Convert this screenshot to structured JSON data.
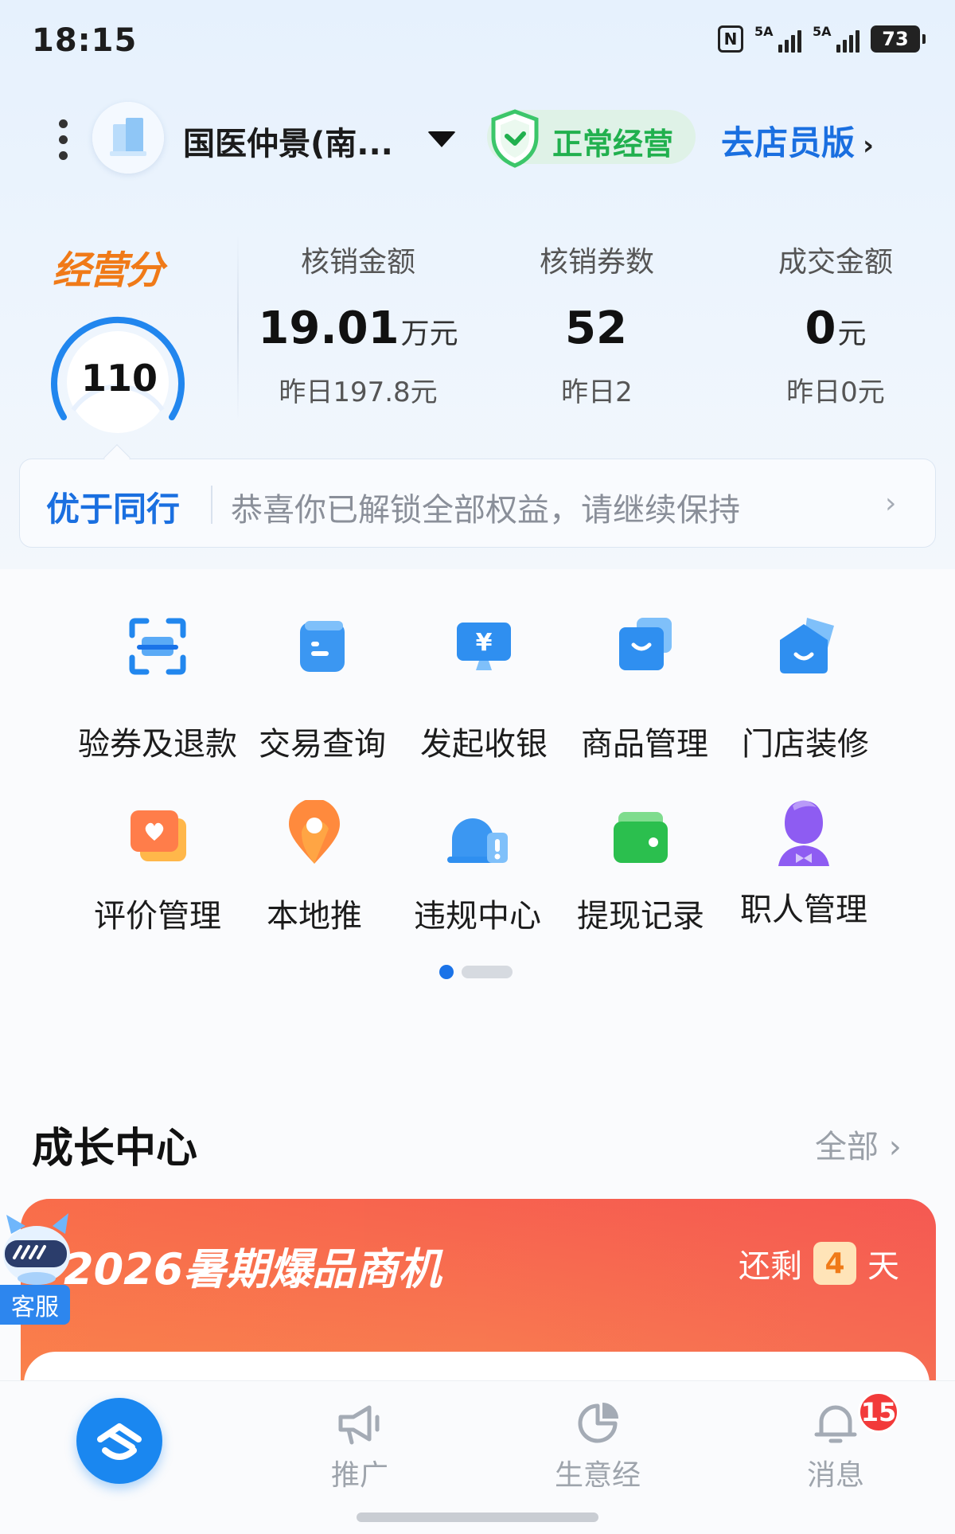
{
  "status_bar": {
    "time": "18:15",
    "nfc": "N",
    "signal1": "5A",
    "signal2": "5A",
    "battery": "73"
  },
  "header": {
    "store_name": "国医仲景(南...",
    "status": "正常经营",
    "clerk_link": "去店员版",
    "clerk_arrow": "›",
    "colors": {
      "accent": "#1a6fe0",
      "ok": "#21b04e"
    }
  },
  "score": {
    "title": "经营分",
    "value": "110"
  },
  "metrics": [
    {
      "label": "核销金额",
      "value": "19.01",
      "unit": "万元",
      "sub": "昨日197.8元"
    },
    {
      "label": "核销券数",
      "value": "52",
      "unit": "",
      "sub": "昨日2"
    },
    {
      "label": "成交金额",
      "value": "0",
      "unit": "元",
      "sub": "昨日0元"
    }
  ],
  "peer": {
    "label": "优于同行",
    "text": "恭喜你已解锁全部权益，请继续保持",
    "arrow": "›"
  },
  "grid": [
    {
      "label": "验券及退款",
      "icon": "scan-coupon-icon"
    },
    {
      "label": "交易查询",
      "icon": "transaction-icon"
    },
    {
      "label": "发起收银",
      "icon": "cashier-icon"
    },
    {
      "label": "商品管理",
      "icon": "goods-icon"
    },
    {
      "label": "门店装修",
      "icon": "store-decor-icon"
    },
    {
      "label": "评价管理",
      "icon": "review-icon"
    },
    {
      "label": "本地推",
      "icon": "local-promo-icon"
    },
    {
      "label": "违规中心",
      "icon": "violation-icon"
    },
    {
      "label": "提现记录",
      "icon": "withdraw-icon"
    },
    {
      "label": "职人管理",
      "icon": "staff-icon"
    }
  ],
  "growth": {
    "title": "成长中心",
    "all_label": "全部",
    "all_arrow": "›"
  },
  "banner": {
    "title": "2026暑期爆品商机",
    "remain_prefix": "还剩",
    "remain_days": "4",
    "remain_suffix": "天"
  },
  "customer_service": {
    "label": "客服"
  },
  "tabs": [
    {
      "label": "推广",
      "icon": "megaphone-icon"
    },
    {
      "label": "生意经",
      "icon": "pie-chart-icon"
    },
    {
      "label": "消息",
      "icon": "bell-icon",
      "badge": "15"
    }
  ]
}
